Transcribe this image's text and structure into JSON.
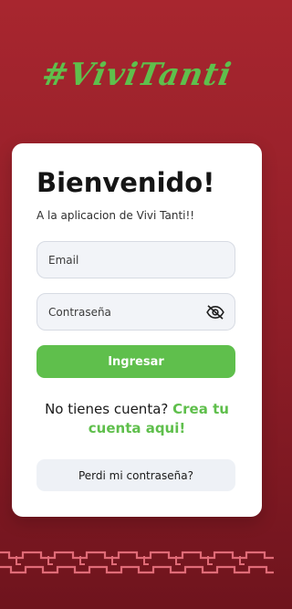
{
  "brand": {
    "logo_text": "#ViviTanti",
    "accent_color": "#5fbf4c",
    "background_color": "#8d1d27"
  },
  "login_card": {
    "title": "Bienvenido!",
    "subtitle": "A la aplicacion de Vivi Tanti!!",
    "email_placeholder": "Email",
    "password_placeholder": "Contraseña",
    "password_toggle_icon": "eye-off-icon",
    "submit_label": "Ingresar",
    "signup_prompt": "No tienes cuenta?",
    "signup_link": "Crea tu cuenta aqui!",
    "forgot_password_label": "Perdi mi contraseña?"
  },
  "decoration": {
    "pattern_icon": "tribal-pattern-icon"
  }
}
